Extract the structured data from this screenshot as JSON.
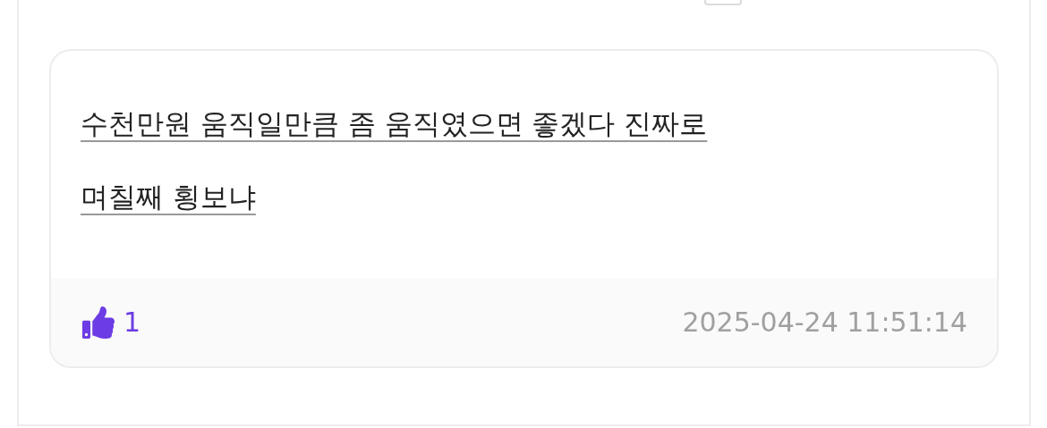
{
  "post": {
    "lines": [
      "수천만원 움직일만큼 좀 움직였으면 좋겠다 진짜로",
      "며칠째 횡보냐"
    ],
    "likes": "1",
    "liked": true,
    "timestamp": "2025-04-24 11:51:14"
  }
}
